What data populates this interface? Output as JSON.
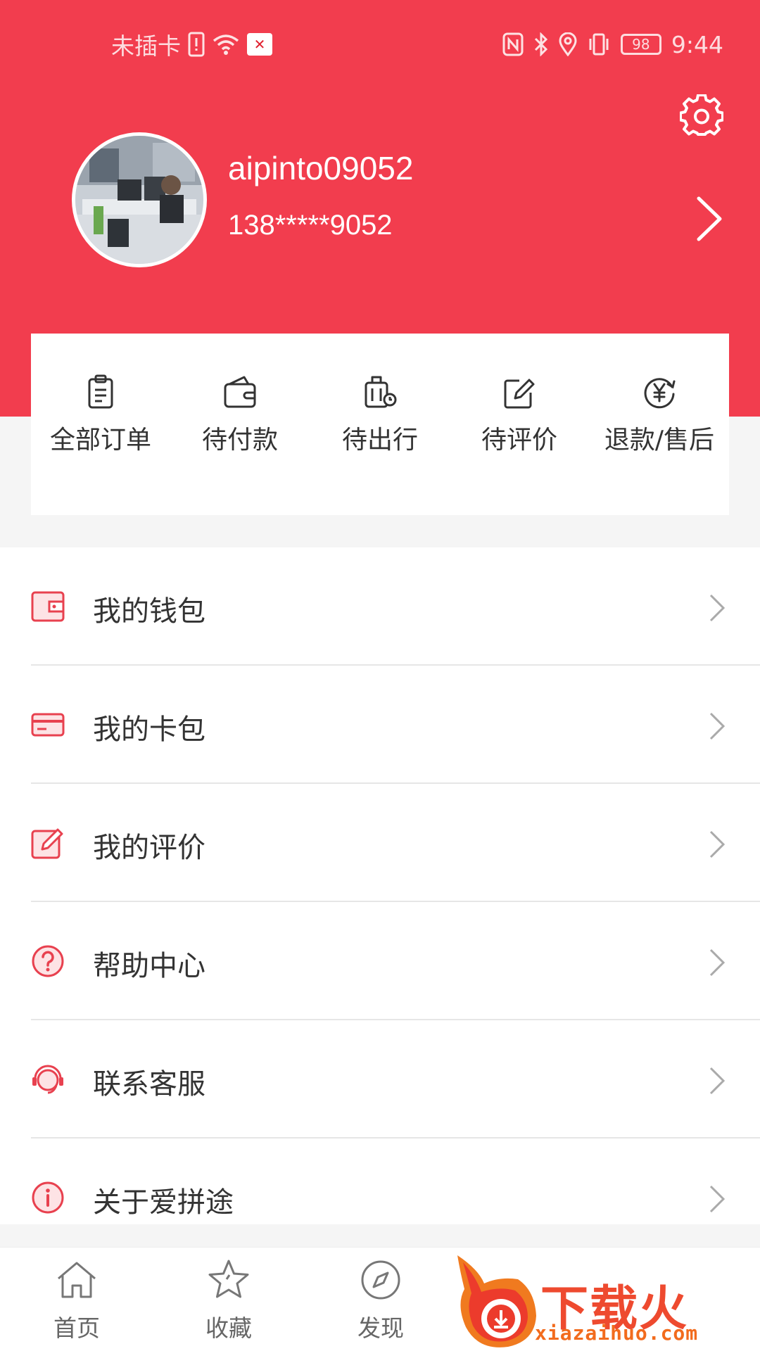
{
  "status_bar": {
    "carrier": "未插卡",
    "battery": "98",
    "time": "9:44"
  },
  "profile": {
    "username": "aipinto09052",
    "phone": "138*****9052"
  },
  "orders": [
    {
      "label": "全部订单",
      "icon": "clipboard-icon"
    },
    {
      "label": "待付款",
      "icon": "wallet-icon"
    },
    {
      "label": "待出行",
      "icon": "luggage-icon"
    },
    {
      "label": "待评价",
      "icon": "edit-icon"
    },
    {
      "label": "退款/售后",
      "icon": "yuan-refund-icon"
    }
  ],
  "menu": [
    {
      "label": "我的钱包",
      "icon": "wallet-icon"
    },
    {
      "label": "我的卡包",
      "icon": "card-icon"
    },
    {
      "label": "我的评价",
      "icon": "edit-icon"
    },
    {
      "label": "帮助中心",
      "icon": "help-icon"
    },
    {
      "label": "联系客服",
      "icon": "headset-icon"
    },
    {
      "label": "关于爱拼途",
      "icon": "info-icon"
    }
  ],
  "bottom_nav": [
    {
      "label": "首页",
      "icon": "home-icon"
    },
    {
      "label": "收藏",
      "icon": "star-icon"
    },
    {
      "label": "发现",
      "icon": "compass-icon"
    }
  ],
  "watermark": {
    "title": "下载火",
    "url": "xiazaihuo.com"
  },
  "colors": {
    "accent": "#f23d4e",
    "menu_icon": "#e8414f"
  }
}
